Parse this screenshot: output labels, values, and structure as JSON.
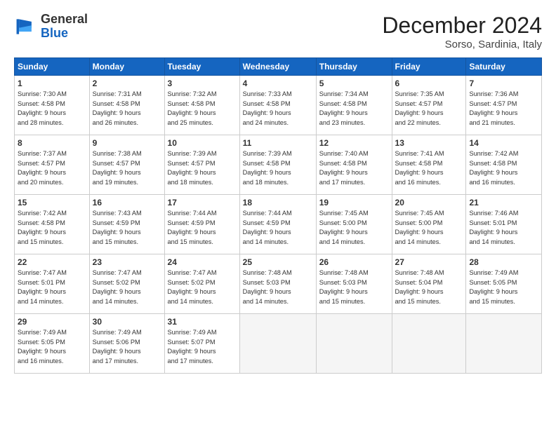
{
  "header": {
    "logo_general": "General",
    "logo_blue": "Blue",
    "month_title": "December 2024",
    "location": "Sorso, Sardinia, Italy"
  },
  "days_of_week": [
    "Sunday",
    "Monday",
    "Tuesday",
    "Wednesday",
    "Thursday",
    "Friday",
    "Saturday"
  ],
  "weeks": [
    [
      {
        "day": "1",
        "info": "Sunrise: 7:30 AM\nSunset: 4:58 PM\nDaylight: 9 hours\nand 28 minutes."
      },
      {
        "day": "2",
        "info": "Sunrise: 7:31 AM\nSunset: 4:58 PM\nDaylight: 9 hours\nand 26 minutes."
      },
      {
        "day": "3",
        "info": "Sunrise: 7:32 AM\nSunset: 4:58 PM\nDaylight: 9 hours\nand 25 minutes."
      },
      {
        "day": "4",
        "info": "Sunrise: 7:33 AM\nSunset: 4:58 PM\nDaylight: 9 hours\nand 24 minutes."
      },
      {
        "day": "5",
        "info": "Sunrise: 7:34 AM\nSunset: 4:58 PM\nDaylight: 9 hours\nand 23 minutes."
      },
      {
        "day": "6",
        "info": "Sunrise: 7:35 AM\nSunset: 4:57 PM\nDaylight: 9 hours\nand 22 minutes."
      },
      {
        "day": "7",
        "info": "Sunrise: 7:36 AM\nSunset: 4:57 PM\nDaylight: 9 hours\nand 21 minutes."
      }
    ],
    [
      {
        "day": "8",
        "info": "Sunrise: 7:37 AM\nSunset: 4:57 PM\nDaylight: 9 hours\nand 20 minutes."
      },
      {
        "day": "9",
        "info": "Sunrise: 7:38 AM\nSunset: 4:57 PM\nDaylight: 9 hours\nand 19 minutes."
      },
      {
        "day": "10",
        "info": "Sunrise: 7:39 AM\nSunset: 4:57 PM\nDaylight: 9 hours\nand 18 minutes."
      },
      {
        "day": "11",
        "info": "Sunrise: 7:39 AM\nSunset: 4:58 PM\nDaylight: 9 hours\nand 18 minutes."
      },
      {
        "day": "12",
        "info": "Sunrise: 7:40 AM\nSunset: 4:58 PM\nDaylight: 9 hours\nand 17 minutes."
      },
      {
        "day": "13",
        "info": "Sunrise: 7:41 AM\nSunset: 4:58 PM\nDaylight: 9 hours\nand 16 minutes."
      },
      {
        "day": "14",
        "info": "Sunrise: 7:42 AM\nSunset: 4:58 PM\nDaylight: 9 hours\nand 16 minutes."
      }
    ],
    [
      {
        "day": "15",
        "info": "Sunrise: 7:42 AM\nSunset: 4:58 PM\nDaylight: 9 hours\nand 15 minutes."
      },
      {
        "day": "16",
        "info": "Sunrise: 7:43 AM\nSunset: 4:59 PM\nDaylight: 9 hours\nand 15 minutes."
      },
      {
        "day": "17",
        "info": "Sunrise: 7:44 AM\nSunset: 4:59 PM\nDaylight: 9 hours\nand 15 minutes."
      },
      {
        "day": "18",
        "info": "Sunrise: 7:44 AM\nSunset: 4:59 PM\nDaylight: 9 hours\nand 14 minutes."
      },
      {
        "day": "19",
        "info": "Sunrise: 7:45 AM\nSunset: 5:00 PM\nDaylight: 9 hours\nand 14 minutes."
      },
      {
        "day": "20",
        "info": "Sunrise: 7:45 AM\nSunset: 5:00 PM\nDaylight: 9 hours\nand 14 minutes."
      },
      {
        "day": "21",
        "info": "Sunrise: 7:46 AM\nSunset: 5:01 PM\nDaylight: 9 hours\nand 14 minutes."
      }
    ],
    [
      {
        "day": "22",
        "info": "Sunrise: 7:47 AM\nSunset: 5:01 PM\nDaylight: 9 hours\nand 14 minutes."
      },
      {
        "day": "23",
        "info": "Sunrise: 7:47 AM\nSunset: 5:02 PM\nDaylight: 9 hours\nand 14 minutes."
      },
      {
        "day": "24",
        "info": "Sunrise: 7:47 AM\nSunset: 5:02 PM\nDaylight: 9 hours\nand 14 minutes."
      },
      {
        "day": "25",
        "info": "Sunrise: 7:48 AM\nSunset: 5:03 PM\nDaylight: 9 hours\nand 14 minutes."
      },
      {
        "day": "26",
        "info": "Sunrise: 7:48 AM\nSunset: 5:03 PM\nDaylight: 9 hours\nand 15 minutes."
      },
      {
        "day": "27",
        "info": "Sunrise: 7:48 AM\nSunset: 5:04 PM\nDaylight: 9 hours\nand 15 minutes."
      },
      {
        "day": "28",
        "info": "Sunrise: 7:49 AM\nSunset: 5:05 PM\nDaylight: 9 hours\nand 15 minutes."
      }
    ],
    [
      {
        "day": "29",
        "info": "Sunrise: 7:49 AM\nSunset: 5:05 PM\nDaylight: 9 hours\nand 16 minutes."
      },
      {
        "day": "30",
        "info": "Sunrise: 7:49 AM\nSunset: 5:06 PM\nDaylight: 9 hours\nand 17 minutes."
      },
      {
        "day": "31",
        "info": "Sunrise: 7:49 AM\nSunset: 5:07 PM\nDaylight: 9 hours\nand 17 minutes."
      },
      null,
      null,
      null,
      null
    ]
  ]
}
